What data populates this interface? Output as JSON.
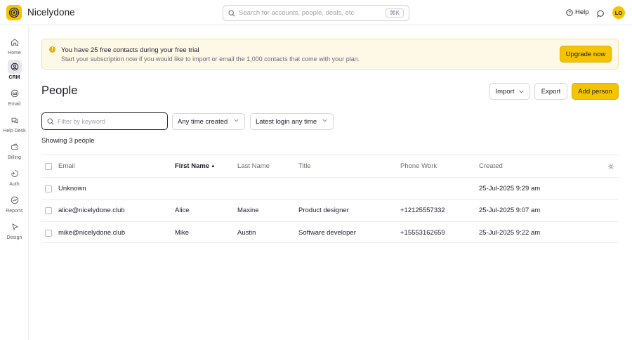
{
  "app": {
    "name": "Nicelydone",
    "logo_color": "#f5c400"
  },
  "search": {
    "placeholder": "Search for accounts, people, deals, etc",
    "shortcut": "⌘K"
  },
  "header": {
    "help_label": "Help",
    "avatar_initials": "LO"
  },
  "sidebar": {
    "items": [
      {
        "label": "Home",
        "icon": "home-icon",
        "active": false
      },
      {
        "label": "CRM",
        "icon": "crm-icon",
        "active": true
      },
      {
        "label": "Email",
        "icon": "email-icon",
        "active": false
      },
      {
        "label": "Help Desk",
        "icon": "help-desk-icon",
        "active": false
      },
      {
        "label": "Billing",
        "icon": "billing-icon",
        "active": false
      },
      {
        "label": "Auth",
        "icon": "auth-icon",
        "active": false
      },
      {
        "label": "Reports",
        "icon": "reports-icon",
        "active": false
      },
      {
        "label": "Design",
        "icon": "design-icon",
        "active": false
      }
    ]
  },
  "banner": {
    "title": "You have 25 free contacts during your free trial",
    "subtitle": "Start your subscription now if you would like to import or email the 1,000 contacts that come with your plan.",
    "upgrade_label": "Upgrade now"
  },
  "page": {
    "title": "People",
    "import_label": "Import",
    "export_label": "Export",
    "add_label": "Add person"
  },
  "filters": {
    "keyword_placeholder": "Filter by keyword",
    "created_value": "Any time created",
    "login_value": "Latest login any time",
    "showing_text": "Showing 3 people"
  },
  "table": {
    "columns": {
      "email": "Email",
      "first_name": "First Name",
      "last_name": "Last Name",
      "title": "Title",
      "phone": "Phone Work",
      "created": "Created"
    },
    "sorted_by": "first_name",
    "rows": [
      {
        "email": "Unknown",
        "first_name": "",
        "last_name": "",
        "title": "",
        "phone": "",
        "created": "25-Jul-2025 9:29 am"
      },
      {
        "email": "alice@nicelydone.club",
        "first_name": "Alice",
        "last_name": "Maxine",
        "title": "Product designer",
        "phone": "+12125557332",
        "created": "25-Jul-2025 9:07 am"
      },
      {
        "email": "mike@nicelydone.club",
        "first_name": "Mike",
        "last_name": "Austin",
        "title": "Software developer",
        "phone": "+15553162659",
        "created": "25-Jul-2025 9:22 am"
      }
    ]
  },
  "colors": {
    "accent": "#f5c400",
    "banner_bg": "#fef9e7",
    "text": "#1f1d2b"
  }
}
